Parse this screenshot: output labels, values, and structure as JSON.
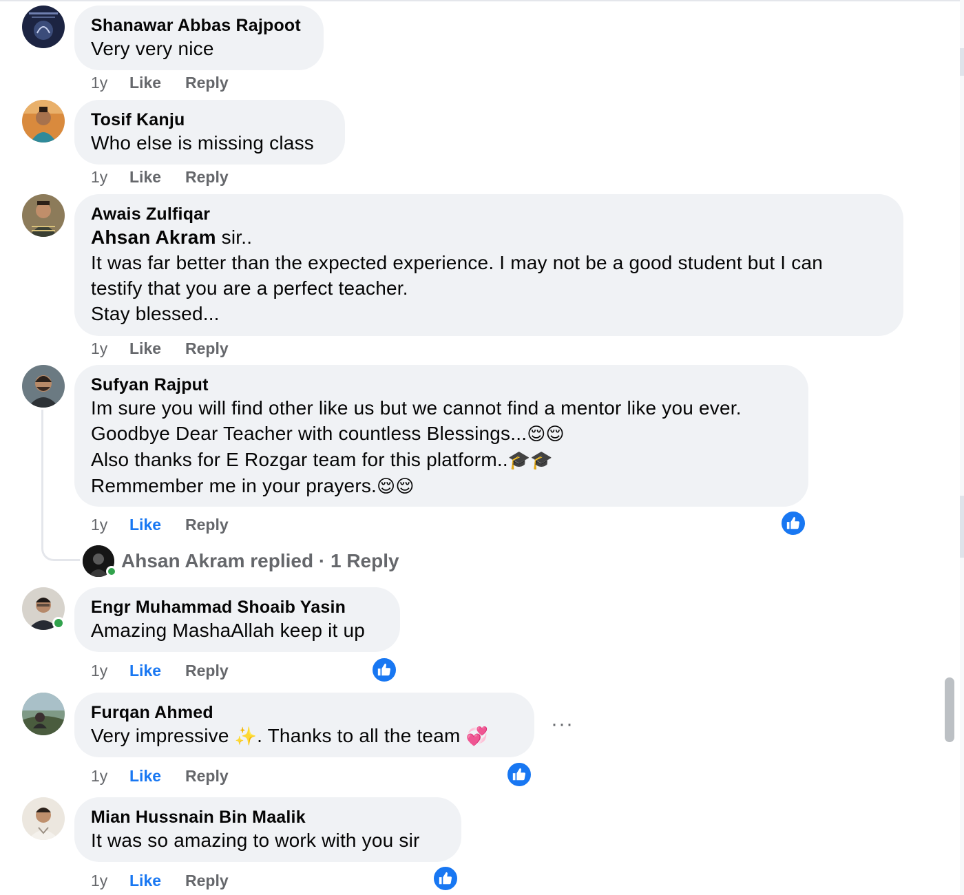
{
  "colors": {
    "accent": "#1877f2",
    "bubble": "#f0f2f5",
    "meta": "#65676b",
    "online": "#31a24c"
  },
  "labels": {
    "like": "Like",
    "reply": "Reply"
  },
  "comments": [
    {
      "author": "Shanawar Abbas Rajpoot",
      "lines": [
        "Very very nice"
      ],
      "time": "1y",
      "liked": false
    },
    {
      "author": "Tosif Kanju",
      "lines": [
        "Who else is missing class"
      ],
      "time": "1y",
      "liked": false
    },
    {
      "author": "Awais Zulfiqar",
      "mention": "Ahsan Akram",
      "mention_suffix": " sir..",
      "lines": [
        "It was far better than the expected experience. I may not be a good student but I can",
        "testify that you are a perfect teacher.",
        "Stay blessed..."
      ],
      "time": "1y",
      "liked": false
    },
    {
      "author": "Sufyan Rajput",
      "lines": [
        "Im sure you will find other like us but we cannot find a mentor like you ever.",
        "Goodbye Dear Teacher with countless Blessings...",
        "Also thanks for E Rozgar team for this platform..",
        "Remmember me in your prayers."
      ],
      "line_emojis": [
        "",
        "😌😌",
        "🎓🎓",
        "😌😌"
      ],
      "time": "1y",
      "liked": true,
      "reactions": "like-icon"
    },
    {
      "author": "Engr Muhammad Shoaib Yasin",
      "lines": [
        "Amazing MashaAllah keep it up"
      ],
      "time": "1y",
      "liked": true,
      "reactions": "like-icon"
    },
    {
      "author": "Furqan Ahmed",
      "text_before": "Very impressive ",
      "emoji_1": "✨",
      "text_after": ". Thanks to all the team ",
      "emoji_2": "💞",
      "time": "1y",
      "liked": true,
      "reactions": "like-icon"
    },
    {
      "author": "Mian Hussnain Bin Maalik",
      "lines": [
        "It was so amazing to work with you sir"
      ],
      "time": "1y",
      "liked": true,
      "reactions": "like-icon"
    }
  ],
  "reply_summary": {
    "name": "Ahsan Akram",
    "action": "replied",
    "separator": "·",
    "count": "1 Reply"
  },
  "more_options": "···"
}
